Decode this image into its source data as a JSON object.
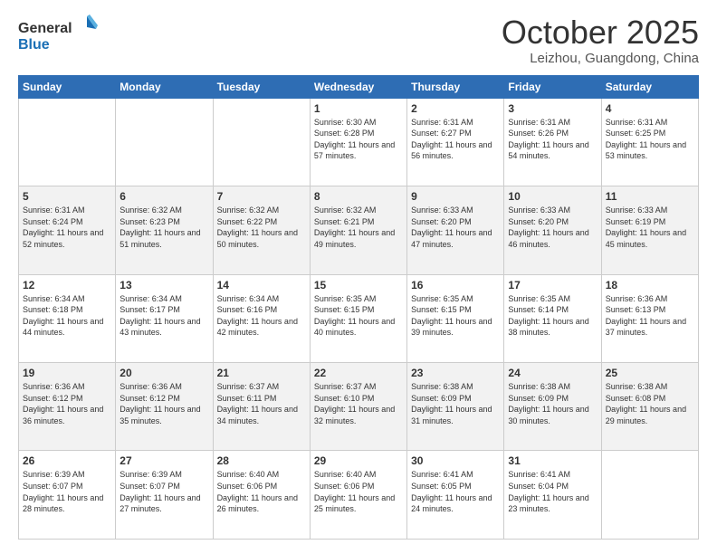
{
  "header": {
    "logo_general": "General",
    "logo_blue": "Blue",
    "month_title": "October 2025",
    "location": "Leizhou, Guangdong, China"
  },
  "days_of_week": [
    "Sunday",
    "Monday",
    "Tuesday",
    "Wednesday",
    "Thursday",
    "Friday",
    "Saturday"
  ],
  "weeks": [
    [
      {
        "day": "",
        "info": ""
      },
      {
        "day": "",
        "info": ""
      },
      {
        "day": "",
        "info": ""
      },
      {
        "day": "1",
        "info": "Sunrise: 6:30 AM\nSunset: 6:28 PM\nDaylight: 11 hours\nand 57 minutes."
      },
      {
        "day": "2",
        "info": "Sunrise: 6:31 AM\nSunset: 6:27 PM\nDaylight: 11 hours\nand 56 minutes."
      },
      {
        "day": "3",
        "info": "Sunrise: 6:31 AM\nSunset: 6:26 PM\nDaylight: 11 hours\nand 54 minutes."
      },
      {
        "day": "4",
        "info": "Sunrise: 6:31 AM\nSunset: 6:25 PM\nDaylight: 11 hours\nand 53 minutes."
      }
    ],
    [
      {
        "day": "5",
        "info": "Sunrise: 6:31 AM\nSunset: 6:24 PM\nDaylight: 11 hours\nand 52 minutes."
      },
      {
        "day": "6",
        "info": "Sunrise: 6:32 AM\nSunset: 6:23 PM\nDaylight: 11 hours\nand 51 minutes."
      },
      {
        "day": "7",
        "info": "Sunrise: 6:32 AM\nSunset: 6:22 PM\nDaylight: 11 hours\nand 50 minutes."
      },
      {
        "day": "8",
        "info": "Sunrise: 6:32 AM\nSunset: 6:21 PM\nDaylight: 11 hours\nand 49 minutes."
      },
      {
        "day": "9",
        "info": "Sunrise: 6:33 AM\nSunset: 6:20 PM\nDaylight: 11 hours\nand 47 minutes."
      },
      {
        "day": "10",
        "info": "Sunrise: 6:33 AM\nSunset: 6:20 PM\nDaylight: 11 hours\nand 46 minutes."
      },
      {
        "day": "11",
        "info": "Sunrise: 6:33 AM\nSunset: 6:19 PM\nDaylight: 11 hours\nand 45 minutes."
      }
    ],
    [
      {
        "day": "12",
        "info": "Sunrise: 6:34 AM\nSunset: 6:18 PM\nDaylight: 11 hours\nand 44 minutes."
      },
      {
        "day": "13",
        "info": "Sunrise: 6:34 AM\nSunset: 6:17 PM\nDaylight: 11 hours\nand 43 minutes."
      },
      {
        "day": "14",
        "info": "Sunrise: 6:34 AM\nSunset: 6:16 PM\nDaylight: 11 hours\nand 42 minutes."
      },
      {
        "day": "15",
        "info": "Sunrise: 6:35 AM\nSunset: 6:15 PM\nDaylight: 11 hours\nand 40 minutes."
      },
      {
        "day": "16",
        "info": "Sunrise: 6:35 AM\nSunset: 6:15 PM\nDaylight: 11 hours\nand 39 minutes."
      },
      {
        "day": "17",
        "info": "Sunrise: 6:35 AM\nSunset: 6:14 PM\nDaylight: 11 hours\nand 38 minutes."
      },
      {
        "day": "18",
        "info": "Sunrise: 6:36 AM\nSunset: 6:13 PM\nDaylight: 11 hours\nand 37 minutes."
      }
    ],
    [
      {
        "day": "19",
        "info": "Sunrise: 6:36 AM\nSunset: 6:12 PM\nDaylight: 11 hours\nand 36 minutes."
      },
      {
        "day": "20",
        "info": "Sunrise: 6:36 AM\nSunset: 6:12 PM\nDaylight: 11 hours\nand 35 minutes."
      },
      {
        "day": "21",
        "info": "Sunrise: 6:37 AM\nSunset: 6:11 PM\nDaylight: 11 hours\nand 34 minutes."
      },
      {
        "day": "22",
        "info": "Sunrise: 6:37 AM\nSunset: 6:10 PM\nDaylight: 11 hours\nand 32 minutes."
      },
      {
        "day": "23",
        "info": "Sunrise: 6:38 AM\nSunset: 6:09 PM\nDaylight: 11 hours\nand 31 minutes."
      },
      {
        "day": "24",
        "info": "Sunrise: 6:38 AM\nSunset: 6:09 PM\nDaylight: 11 hours\nand 30 minutes."
      },
      {
        "day": "25",
        "info": "Sunrise: 6:38 AM\nSunset: 6:08 PM\nDaylight: 11 hours\nand 29 minutes."
      }
    ],
    [
      {
        "day": "26",
        "info": "Sunrise: 6:39 AM\nSunset: 6:07 PM\nDaylight: 11 hours\nand 28 minutes."
      },
      {
        "day": "27",
        "info": "Sunrise: 6:39 AM\nSunset: 6:07 PM\nDaylight: 11 hours\nand 27 minutes."
      },
      {
        "day": "28",
        "info": "Sunrise: 6:40 AM\nSunset: 6:06 PM\nDaylight: 11 hours\nand 26 minutes."
      },
      {
        "day": "29",
        "info": "Sunrise: 6:40 AM\nSunset: 6:06 PM\nDaylight: 11 hours\nand 25 minutes."
      },
      {
        "day": "30",
        "info": "Sunrise: 6:41 AM\nSunset: 6:05 PM\nDaylight: 11 hours\nand 24 minutes."
      },
      {
        "day": "31",
        "info": "Sunrise: 6:41 AM\nSunset: 6:04 PM\nDaylight: 11 hours\nand 23 minutes."
      },
      {
        "day": "",
        "info": ""
      }
    ]
  ]
}
